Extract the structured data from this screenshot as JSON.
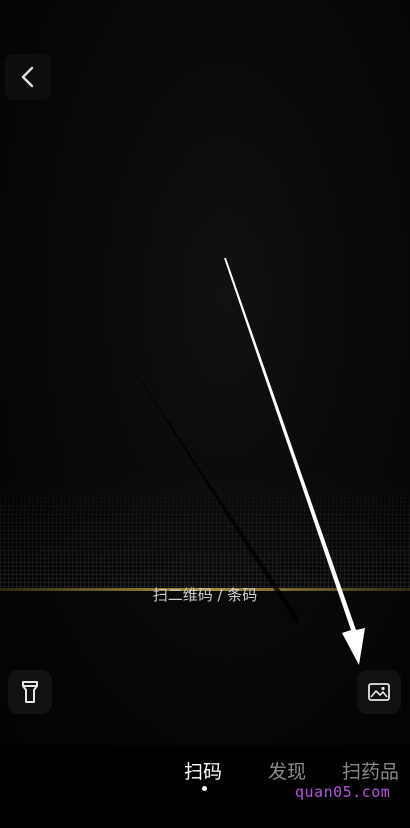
{
  "scan_hint": "扫二维码 / 条码",
  "tabs": [
    {
      "label": "扫码",
      "active": true
    },
    {
      "label": "发现",
      "active": false
    },
    {
      "label": "扫药品",
      "active": false
    }
  ],
  "watermark": "quan05.com",
  "icons": {
    "back": "chevron-left-icon",
    "flashlight": "flashlight-icon",
    "album": "image-icon"
  },
  "colors": {
    "scan_line": "#c8aa46",
    "watermark": "#b455e0",
    "tab_active": "#ffffff",
    "tab_inactive": "#8a8a8a"
  }
}
